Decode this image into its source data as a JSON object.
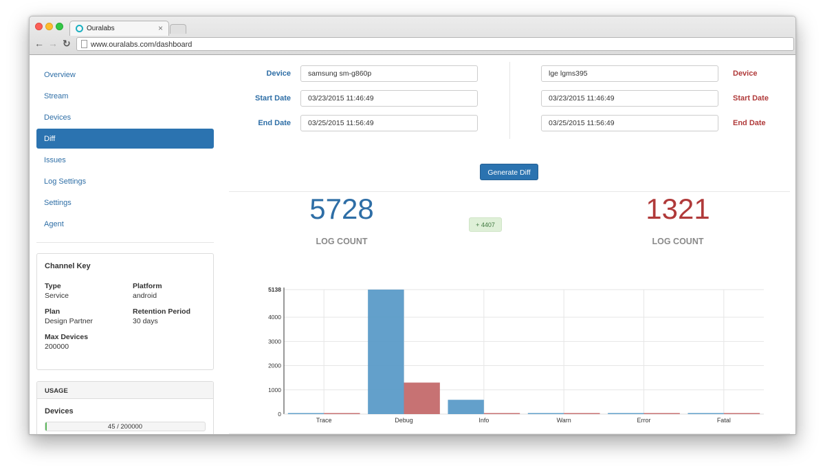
{
  "browser": {
    "tab_title": "Ouralabs",
    "tab_close": "×",
    "url": "www.ouralabs.com/dashboard",
    "back": "←",
    "forward": "→",
    "reload": "↻"
  },
  "sidebar": {
    "items": [
      {
        "label": "Overview"
      },
      {
        "label": "Stream"
      },
      {
        "label": "Devices"
      },
      {
        "label": "Diff",
        "active": true
      },
      {
        "label": "Issues"
      },
      {
        "label": "Log Settings"
      },
      {
        "label": "Settings"
      },
      {
        "label": "Agent"
      }
    ],
    "channel_key": {
      "title": "Channel Key",
      "type_label": "Type",
      "type_value": "Service",
      "platform_label": "Platform",
      "platform_value": "android",
      "plan_label": "Plan",
      "plan_value": "Design Partner",
      "retention_label": "Retention Period",
      "retention_value": "30 days",
      "max_devices_label": "Max Devices",
      "max_devices_value": "200000"
    },
    "usage": {
      "title": "USAGE",
      "devices_label": "Devices",
      "progress_text": "45 / 200000",
      "progress_fraction": 0.000225
    }
  },
  "diff_form": {
    "left": {
      "device_label": "Device",
      "device_value": "samsung sm-g860p",
      "start_label": "Start Date",
      "start_value": "03/23/2015 11:46:49",
      "end_label": "End Date",
      "end_value": "03/25/2015 11:56:49"
    },
    "right": {
      "device_label": "Device",
      "device_value": "lge lgms395",
      "start_label": "Start Date",
      "start_value": "03/23/2015 11:46:49",
      "end_label": "End Date",
      "end_value": "03/25/2015 11:56:49"
    },
    "generate_label": "Generate Diff"
  },
  "counts": {
    "left_value": "5728",
    "left_label": "LOG COUNT",
    "diff_badge": "+ 4407",
    "right_value": "1321",
    "right_label": "LOG COUNT"
  },
  "colors": {
    "left_series": "#5b9bc8",
    "right_series": "#c46a6b",
    "primary": "#2b73b0",
    "danger": "#b03a3a"
  },
  "chart_data": {
    "type": "bar",
    "categories": [
      "Trace",
      "Debug",
      "Info",
      "Warn",
      "Error",
      "Fatal"
    ],
    "series": [
      {
        "values": [
          0,
          5138,
          590,
          0,
          0,
          0
        ]
      },
      {
        "values": [
          0,
          1300,
          21,
          0,
          0,
          0
        ]
      }
    ],
    "y_ticks": [
      0,
      1000,
      2000,
      3000,
      4000,
      5138
    ],
    "ylim": [
      0,
      5138
    ],
    "grid": true
  }
}
